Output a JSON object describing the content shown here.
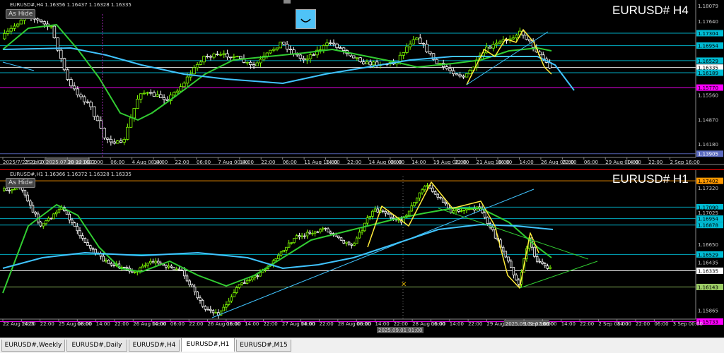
{
  "upper": {
    "symbol_line": "EURUSD#,H4  1.16356 1.16437 1.16328 1.16335",
    "tf_label": "EURUSD# H4",
    "hide_label": "As Hide",
    "price_levels": [
      {
        "text": "1.18079",
        "value": 1.18079,
        "bg": "#000000",
        "fg": "#c8c8c8"
      },
      {
        "text": "1.17640",
        "value": 1.1764,
        "bg": "#000000",
        "fg": "#c8c8c8"
      },
      {
        "text": "1.17304",
        "value": 1.17304,
        "bg": "#00bcd4",
        "fg": "#000000"
      },
      {
        "text": "1.16954",
        "value": 1.16954,
        "bg": "#00bcd4",
        "fg": "#000000"
      },
      {
        "text": "1.16529",
        "value": 1.16529,
        "bg": "#00bcd4",
        "fg": "#000000"
      },
      {
        "text": "1.16335",
        "value": 1.16335,
        "bg": "#ffffff",
        "fg": "#000000"
      },
      {
        "text": "1.16189",
        "value": 1.16189,
        "bg": "#00bcd4",
        "fg": "#000000"
      },
      {
        "text": "1.15770",
        "value": 1.1577,
        "bg": "#ff00ff",
        "fg": "#000000"
      },
      {
        "text": "1.15560",
        "value": 1.1556,
        "bg": "#000000",
        "fg": "#c8c8c8"
      },
      {
        "text": "1.14870",
        "value": 1.1487,
        "bg": "#000000",
        "fg": "#c8c8c8"
      },
      {
        "text": "1.14180",
        "value": 1.1418,
        "bg": "#000000",
        "fg": "#c8c8c8"
      },
      {
        "text": "1.13905",
        "value": 1.13905,
        "bg": "#5c6bc0",
        "fg": "#ffffff"
      }
    ],
    "time_labels": [
      "2025/7/23 22:00",
      "25 Jul 2025",
      "2025.07.28 22:00",
      "30 Jul 16:00",
      "22:00",
      "06:00",
      "4 Aug 08:00",
      "14:00",
      "22:00",
      "06:00",
      "7 Aug 00:00",
      "14:00",
      "22:00",
      "06:00",
      "11 Aug 16:00",
      "14:00",
      "22:00",
      "14 Aug 08:00",
      "06:00",
      "14:00",
      "19 Aug 00:00",
      "22:00",
      "21 Aug 16:00",
      "06:00",
      "14:00",
      "26 Aug 08:00",
      "22:00",
      "06:00",
      "29 Aug 00:00",
      "14:00",
      "22:00",
      "2 Sep 16:00"
    ],
    "date_label_left": "23 Jul 2025",
    "highlight_time": "2025.07.28 22:00"
  },
  "lower": {
    "symbol_line": "EURUSD#,H1  1.16366 1.16372 1.16328 1.16335",
    "tf_label": "EURUSD# H1",
    "hide_label": "As Hide",
    "price_levels": [
      {
        "text": "1.17402",
        "value": 1.17402,
        "bg": "#ff9800",
        "fg": "#000000"
      },
      {
        "text": "1.17320",
        "value": 1.1732,
        "bg": "#000000",
        "fg": "#c8c8c8"
      },
      {
        "text": "1.17090",
        "value": 1.1709,
        "bg": "#00bcd4",
        "fg": "#000000"
      },
      {
        "text": "1.17025",
        "value": 1.17025,
        "bg": "#000000",
        "fg": "#c8c8c8"
      },
      {
        "text": "1.16954",
        "value": 1.16954,
        "bg": "#00bcd4",
        "fg": "#000000"
      },
      {
        "text": "1.16878",
        "value": 1.16878,
        "bg": "#00bcd4",
        "fg": "#000000"
      },
      {
        "text": "1.16650",
        "value": 1.1665,
        "bg": "#000000",
        "fg": "#c8c8c8"
      },
      {
        "text": "1.16529",
        "value": 1.16529,
        "bg": "#00bcd4",
        "fg": "#000000"
      },
      {
        "text": "1.16435",
        "value": 1.16435,
        "bg": "#000000",
        "fg": "#c8c8c8"
      },
      {
        "text": "1.16335",
        "value": 1.16335,
        "bg": "#ffffff",
        "fg": "#000000"
      },
      {
        "text": "1.16143",
        "value": 1.16143,
        "bg": "#9ccc65",
        "fg": "#000000"
      },
      {
        "text": "1.15865",
        "value": 1.15865,
        "bg": "#000000",
        "fg": "#c8c8c8"
      },
      {
        "text": "1.15733",
        "value": 1.15733,
        "bg": "#ff00ff",
        "fg": "#000000"
      }
    ],
    "time_labels": [
      "22 Aug 2025",
      "14:00",
      "22:00",
      "25 Aug 08:00",
      "06:00",
      "14:00",
      "22:00",
      "26 Aug 00:00",
      "14:00",
      "06:00",
      "22:00",
      "26 Aug 16:00",
      "06:00",
      "14:00",
      "22:00",
      "27 Aug 08:00",
      "14:00",
      "22:00",
      "28 Aug 00:00",
      "06:00",
      "14:00",
      "22:00",
      "28 Aug 16:00",
      "06:00",
      "14:00",
      "22:00",
      "29 Aug 08:00",
      "2025.09.01 07:00",
      "1 Sep 16:00",
      "06:00",
      "14:00",
      "22:00",
      "2 Sep 08:00",
      "14:00",
      "22:00",
      "06:00",
      "3 Sep 00:00"
    ],
    "date_label_left": "2025/8/22 06:00",
    "highlight_time": "2025.09.01 07:00",
    "highlight_time2": "2025.09.01 01:00"
  },
  "tabs": [
    "EURUSD#,Weekly",
    "EURUSD#,Daily",
    "EURUSD#,H4",
    "EURUSD#,H1",
    "EURUSD#,M15"
  ],
  "active_tab": "EURUSD#,H1"
}
